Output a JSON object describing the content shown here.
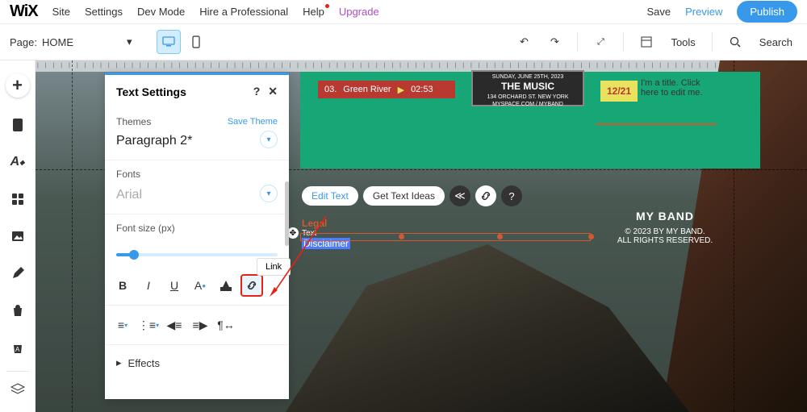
{
  "logo": "WiX",
  "menu": {
    "site": "Site",
    "settings": "Settings",
    "devmode": "Dev Mode",
    "hire": "Hire a Professional",
    "help": "Help",
    "upgrade": "Upgrade",
    "save": "Save",
    "preview": "Preview",
    "publish": "Publish"
  },
  "toolbar": {
    "page_label": "Page:",
    "page_name": "HOME",
    "tools": "Tools",
    "search": "Search"
  },
  "panel": {
    "title": "Text Settings",
    "themes_label": "Themes",
    "save_theme": "Save Theme",
    "theme_value": "Paragraph 2*",
    "fonts_label": "Fonts",
    "font_value": "Arial",
    "fontsize_label": "Font size (px)",
    "effects": "Effects",
    "link_tooltip": "Link"
  },
  "flyout": {
    "edit": "Edit Text",
    "ideas": "Get Text Ideas"
  },
  "content": {
    "track_num": "03.",
    "track_name": "Green River",
    "track_time": "02:53",
    "poster_line1": "SUNDAY, JUNE 25TH, 2023",
    "poster_title": "THE MUSIC",
    "poster_addr": "134 ORCHARD ST.   NEW YORK",
    "poster_site": "MYSPACE.COM / MYBAND",
    "date_badge": "12/21",
    "title_hint": "I'm a title. Click here to edit me.",
    "legal": "Legal",
    "text_label": "Text",
    "disclaimer": "Disclaimer",
    "band": "MY BAND",
    "copyright": "© 2023 BY MY BAND.",
    "rights": "ALL RIGHTS RESERVED."
  }
}
